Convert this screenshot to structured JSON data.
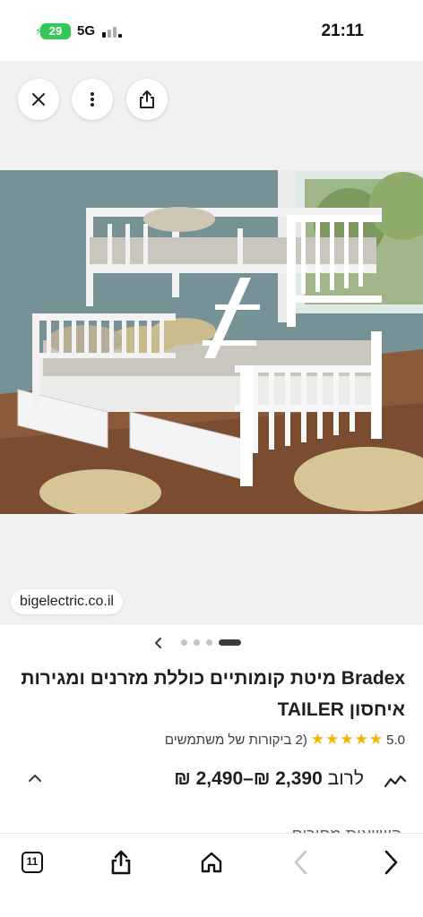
{
  "status_bar": {
    "battery": "29",
    "network": "5G",
    "time": "21:11"
  },
  "image_viewer": {
    "close_icon": "close-icon",
    "more_icon": "more-vertical-icon",
    "share_icon": "share-icon",
    "source": "bigelectric.co.il"
  },
  "carousel": {
    "total_dots": 4,
    "active_index": 3
  },
  "product": {
    "title": "Bradex מיטת קומותיים כוללת מזרנים ומגירות איחסון TAILER",
    "rating_score": "5.0",
    "stars": 5,
    "reviews_text": "(2 ביקורות של משתמשים",
    "price_prefix": "לרוב",
    "price_range": "2,390 ₪–2,490 ₪"
  },
  "next_section": "השוואות מחירים",
  "toolbar": {
    "tabs_count": "11",
    "icons": [
      "tabs-icon",
      "share-icon",
      "home-icon",
      "back-icon",
      "forward-icon"
    ]
  },
  "colors": {
    "accent_star": "#f4b400",
    "battery": "#34c759"
  }
}
